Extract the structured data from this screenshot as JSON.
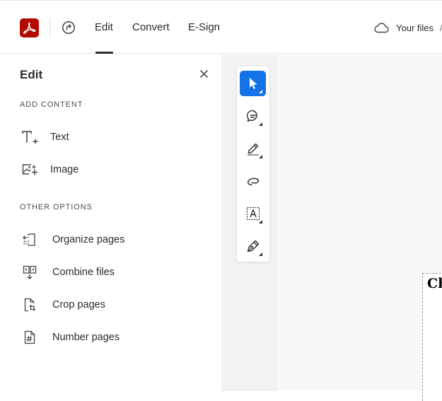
{
  "header": {
    "tabs": [
      {
        "label": "Edit",
        "active": true
      },
      {
        "label": "Convert",
        "active": false
      },
      {
        "label": "E-Sign",
        "active": false
      }
    ],
    "files_label": "Your files",
    "files_separator": "/"
  },
  "panel": {
    "title": "Edit",
    "sections": {
      "add_content": {
        "label": "ADD CONTENT",
        "items": [
          {
            "label": "Text",
            "icon": "add-text-icon"
          },
          {
            "label": "Image",
            "icon": "add-image-icon"
          }
        ]
      },
      "other_options": {
        "label": "OTHER OPTIONS",
        "items": [
          {
            "label": "Organize pages",
            "icon": "organize-pages-icon"
          },
          {
            "label": "Combine files",
            "icon": "combine-files-icon"
          },
          {
            "label": "Crop pages",
            "icon": "crop-pages-icon"
          },
          {
            "label": "Number pages",
            "icon": "number-pages-icon"
          }
        ]
      }
    }
  },
  "toolbar": {
    "tools": [
      {
        "name": "select-tool",
        "icon": "cursor-icon",
        "active": true
      },
      {
        "name": "comment-tool",
        "icon": "comment-icon",
        "active": false
      },
      {
        "name": "highlight-tool",
        "icon": "highlighter-icon",
        "active": false
      },
      {
        "name": "draw-tool",
        "icon": "freehand-icon",
        "active": false
      },
      {
        "name": "text-box-tool",
        "icon": "text-box-icon",
        "active": false
      },
      {
        "name": "sign-tool",
        "icon": "pen-icon",
        "active": false
      }
    ]
  },
  "document": {
    "visible_text": "Ch"
  },
  "colors": {
    "brand": "#b30b00",
    "accent": "#1473e6",
    "text": "#2c2c2c"
  }
}
